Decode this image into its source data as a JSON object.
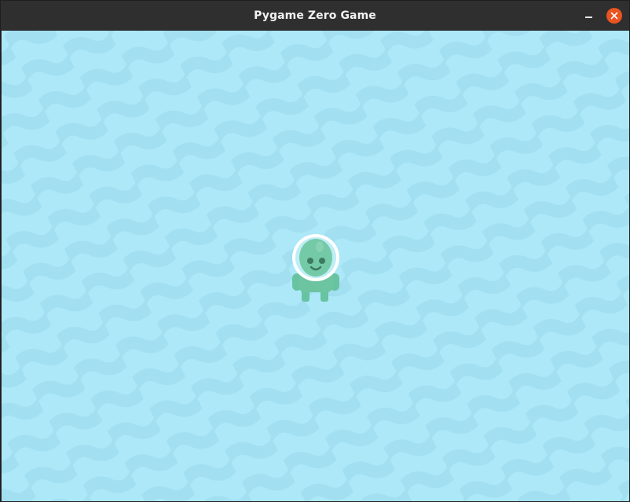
{
  "window": {
    "title": "Pygame Zero Game",
    "controls": [
      "minimize-icon",
      "close-icon"
    ],
    "close_color": "#e95420",
    "titlebar_color": "#2f2f2f"
  },
  "game": {
    "background_color": "#ade8f8",
    "wave_color": "#9ddcee",
    "sprite": {
      "name": "alien",
      "body_color": "#6cc4a1",
      "helmet_color": "#ffffff"
    }
  }
}
